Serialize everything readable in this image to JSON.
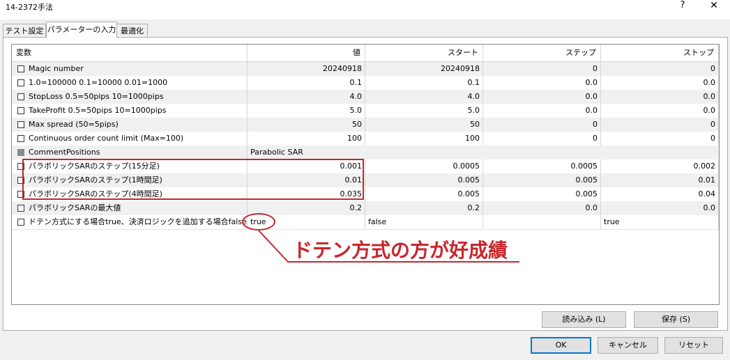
{
  "window": {
    "title": "14-2372手法",
    "help": "?",
    "close": "✕"
  },
  "tabs": [
    "テスト設定",
    "パラメーターの入力",
    "最適化"
  ],
  "grid": {
    "headers": [
      "変数",
      "値",
      "スタート",
      "ステップ",
      "ストップ"
    ],
    "rows": [
      {
        "name": "Magic number",
        "value": "20240918",
        "start": "20240918",
        "step": "0",
        "stop": "0"
      },
      {
        "name": "1.0=100000 0.1=10000 0.01=1000",
        "value": "0.1",
        "start": "0.1",
        "step": "0.0",
        "stop": "0.0"
      },
      {
        "name": "StopLoss 0.5=50pips 10=1000pips",
        "value": "4.0",
        "start": "4.0",
        "step": "0.0",
        "stop": "0.0"
      },
      {
        "name": "TakeProfit 0.5=50pips 10=1000pips",
        "value": "5.0",
        "start": "5.0",
        "step": "0.0",
        "stop": "0.0"
      },
      {
        "name": "Max spread (50=5pips)",
        "value": "50",
        "start": "50",
        "step": "0",
        "stop": "0"
      },
      {
        "name": "Continuous order count limit (Max=100)",
        "value": "100",
        "start": "100",
        "step": "0",
        "stop": "0"
      },
      {
        "name": "CommentPositions",
        "value": "Parabolic SAR",
        "start": "",
        "step": "",
        "stop": ""
      },
      {
        "name": "パラボリックSARのステップ(15分足)",
        "value": "0.001",
        "start": "0.0005",
        "step": "0.0005",
        "stop": "0.002"
      },
      {
        "name": "パラボリックSARのステップ(1時間足)",
        "value": "0.01",
        "start": "0.005",
        "step": "0.005",
        "stop": "0.01"
      },
      {
        "name": "パラボリックSARのステップ(4時間足)",
        "value": "0.035",
        "start": "0.005",
        "step": "0.005",
        "stop": "0.04"
      },
      {
        "name": "パラボリックSARの最大値",
        "value": "0.2",
        "start": "0.2",
        "step": "0.0",
        "stop": "0.0"
      },
      {
        "name": "ドテン方式にする場合true、決済ロジックを追加する場合false",
        "value": "true",
        "start": "false",
        "step": "",
        "stop": "true"
      }
    ]
  },
  "annotation": {
    "callout": "ドテン方式の方が好成績",
    "color": "#c8262c"
  },
  "buttons": {
    "load": "読み込み (L)",
    "save": "保存 (S)",
    "ok": "OK",
    "cancel": "キャンセル",
    "reset": "リセット"
  }
}
